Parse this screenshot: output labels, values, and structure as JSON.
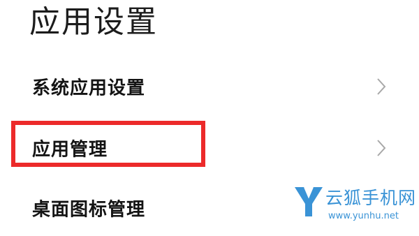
{
  "page": {
    "title": "应用设置"
  },
  "menu": {
    "items": [
      {
        "label": "系统应用设置",
        "icon": "chevron-right-icon"
      },
      {
        "label": "应用管理",
        "icon": "chevron-right-icon"
      },
      {
        "label": "桌面图标管理",
        "icon": "chevron-right-icon"
      }
    ]
  },
  "highlight": {
    "color": "#ec2a2a"
  },
  "watermark": {
    "name": "云狐手机网",
    "url": "www.yunhu.net",
    "color": "#3a93d6"
  }
}
